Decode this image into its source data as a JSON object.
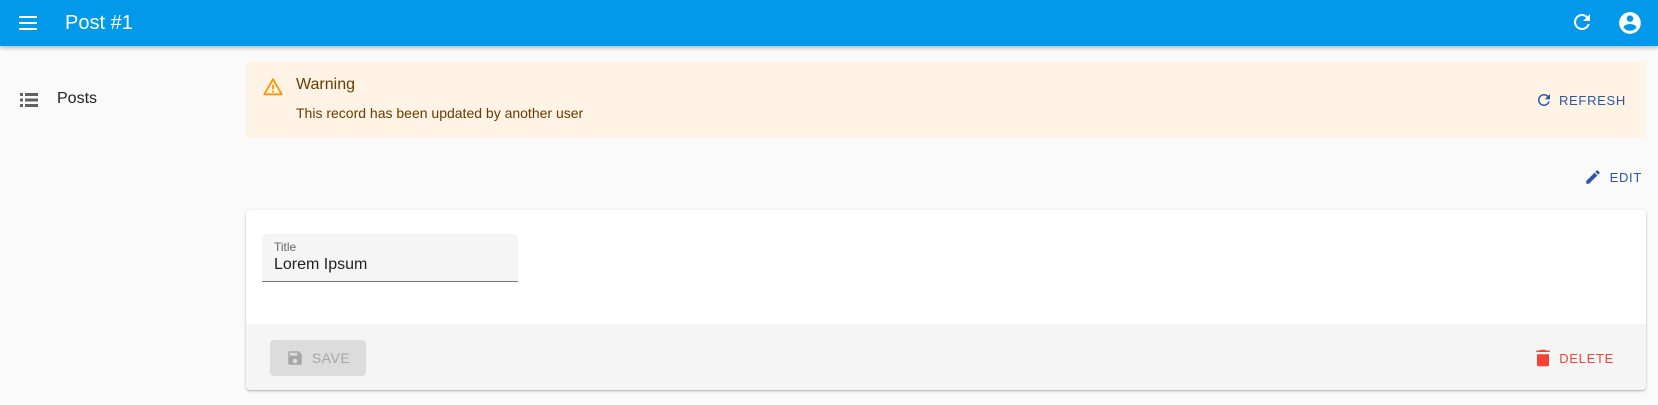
{
  "app_bar": {
    "title": "Post #1",
    "menu_icon": "menu-icon",
    "refresh_icon": "refresh-icon",
    "account_icon": "account-circle-icon",
    "background": "#0299ea"
  },
  "sidebar": {
    "items": [
      {
        "label": "Posts",
        "icon": "list-icon"
      }
    ]
  },
  "alert": {
    "severity": "warning",
    "title": "Warning",
    "message": "This record has been updated by another user",
    "action_label": "REFRESH",
    "action_icon": "refresh-icon",
    "background": "#fef3e5",
    "icon_color": "#ff9800"
  },
  "actions": {
    "edit_label": "EDIT",
    "edit_icon": "pencil-icon"
  },
  "form": {
    "fields": [
      {
        "label": "Title",
        "value": "Lorem Ipsum"
      }
    ],
    "toolbar": {
      "save_label": "SAVE",
      "save_icon": "save-icon",
      "save_disabled": true,
      "delete_label": "DELETE",
      "delete_icon": "trash-icon",
      "delete_color": "#f44336"
    }
  },
  "colors": {
    "primary_action": "#2f56a6"
  }
}
